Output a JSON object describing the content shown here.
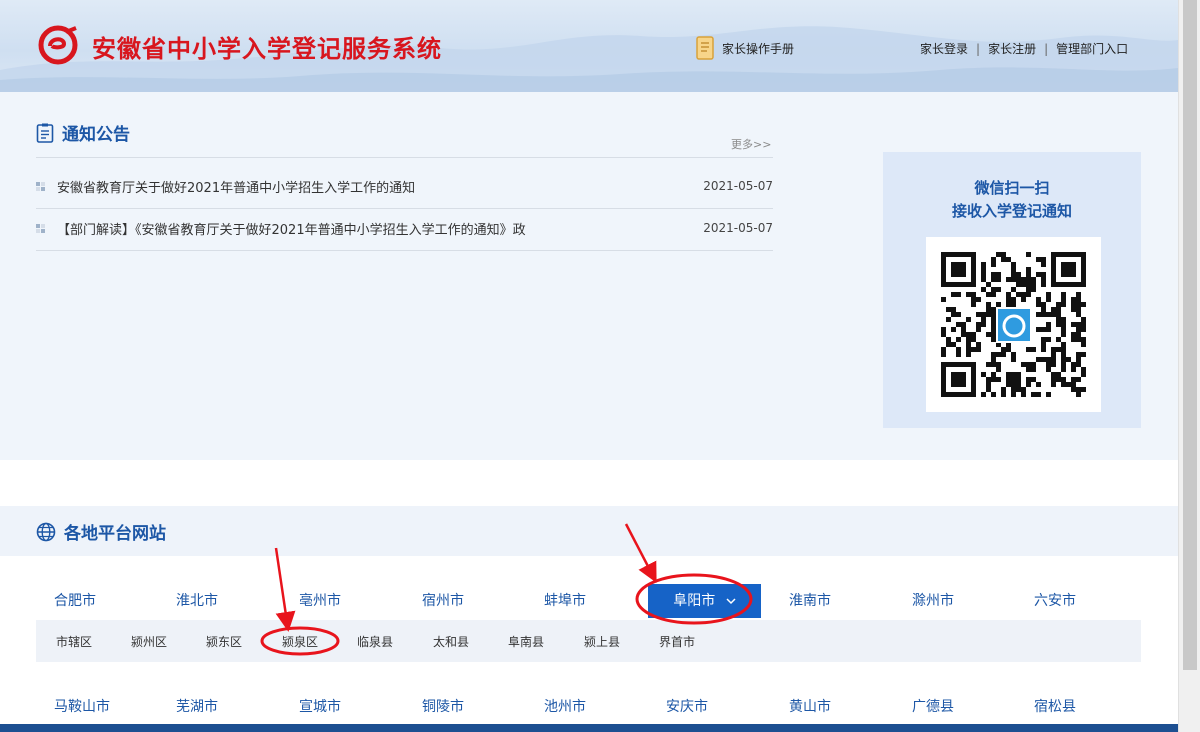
{
  "header": {
    "site_title": "安徽省中小学入学登记服务系统",
    "manual_label": "家长操作手册",
    "links": [
      "家长登录",
      "家长注册",
      "管理部门入口"
    ],
    "separator": "|"
  },
  "notice": {
    "title": "通知公告",
    "more_label": "更多>>",
    "items": [
      {
        "text": "安徽省教育厅关于做好2021年普通中小学招生入学工作的通知",
        "date": "2021-05-07"
      },
      {
        "text": "【部门解读】《安徽省教育厅关于做好2021年普通中小学招生入学工作的通知》政",
        "date": "2021-05-07"
      }
    ]
  },
  "wechat": {
    "line1": "微信扫一扫",
    "line2": "接收入学登记通知"
  },
  "platforms": {
    "title": "各地平台网站",
    "row1": [
      "合肥市",
      "淮北市",
      "亳州市",
      "宿州市",
      "蚌埠市",
      "阜阳市",
      "淮南市",
      "滁州市",
      "六安市"
    ],
    "active_city": "阜阳市",
    "districts": [
      "市辖区",
      "颍州区",
      "颍东区",
      "颍泉区",
      "临泉县",
      "太和县",
      "阜南县",
      "颍上县",
      "界首市"
    ],
    "highlighted_district": "颍泉区",
    "row2": [
      "马鞍山市",
      "芜湖市",
      "宣城市",
      "铜陵市",
      "池州市",
      "安庆市",
      "黄山市",
      "广德县",
      "宿松县"
    ]
  },
  "colors": {
    "brand_red": "#d8161e",
    "brand_blue": "#1d57a6",
    "active_bg": "#1663c7",
    "annotation_red": "#e8141c"
  },
  "icons": [
    "logo-icon",
    "manual-book-icon",
    "notice-document-icon",
    "bullet-icon",
    "globe-icon",
    "chevron-down-icon",
    "qr-code"
  ]
}
